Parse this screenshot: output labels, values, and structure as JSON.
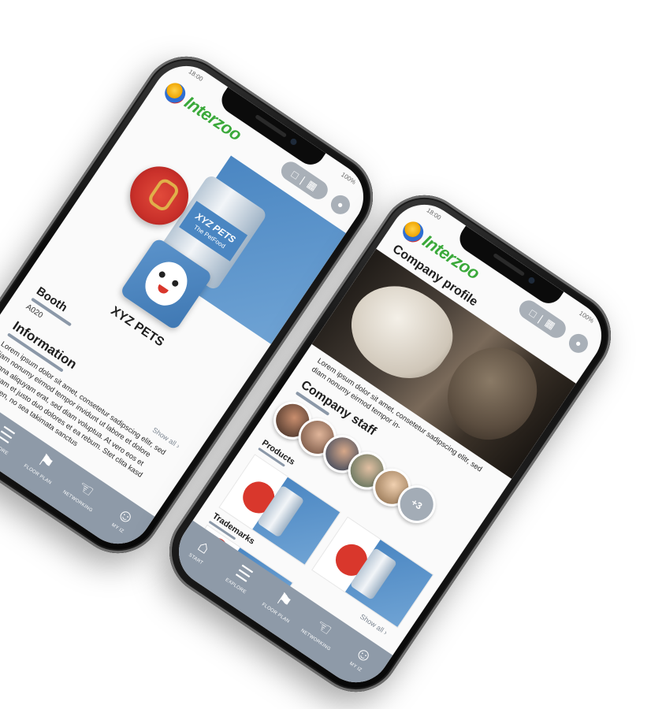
{
  "phone_back": {
    "status": {
      "time": "18:00",
      "battery": "100%"
    },
    "header": {
      "logo_text": "Interzoo"
    },
    "brand": {
      "name": "XYZ PETS"
    },
    "booth": {
      "title": "Booth",
      "value": "A020"
    },
    "information": {
      "title": "Information",
      "text": "Lorem ipsum dolor sit amet, consetetur sadipscing elitr, sed diam nonumy eirmod tempor invidunt ut labore et dolore magna aliquyam erat, sed diam voluptua. At vero eos et accusam et justo duo dolores et ea rebum. Stet clita kasd gubergren, no sea takimata sanctus",
      "show_all": "Show all"
    },
    "product_labels": {
      "can_label": "XYZ PETS",
      "can_sub": "The PetFood"
    }
  },
  "phone_front": {
    "status": {
      "time": "18:00",
      "battery": "100%"
    },
    "header": {
      "logo_text": "Interzoo"
    },
    "company_profile": {
      "title": "Company profile",
      "text": "Lorem ipsum dolor sit amet, consetetur sadipscing elitr, sed diam nonumy eirmod tempor in-"
    },
    "company_staff": {
      "title": "Company staff",
      "more_count": "+3"
    },
    "products": {
      "title": "Products"
    },
    "trademarks": {
      "title": "Trademarks",
      "show_all": "Show all"
    }
  },
  "tabbar": {
    "items": [
      {
        "label": "START",
        "icon": "home-icon"
      },
      {
        "label": "EXPLORE",
        "icon": "search-list-icon"
      },
      {
        "label": "FLOOR PLAN",
        "icon": "map-pin-icon"
      },
      {
        "label": "NETWORKING",
        "icon": "handshake-icon"
      },
      {
        "label": "MY IZ",
        "icon": "profile-list-icon"
      }
    ]
  },
  "colors": {
    "brand_green": "#3aa93a",
    "tabbar_gray": "#8e9aa8",
    "accent_blue": "#4a86c2",
    "can_red": "#d9372c"
  }
}
